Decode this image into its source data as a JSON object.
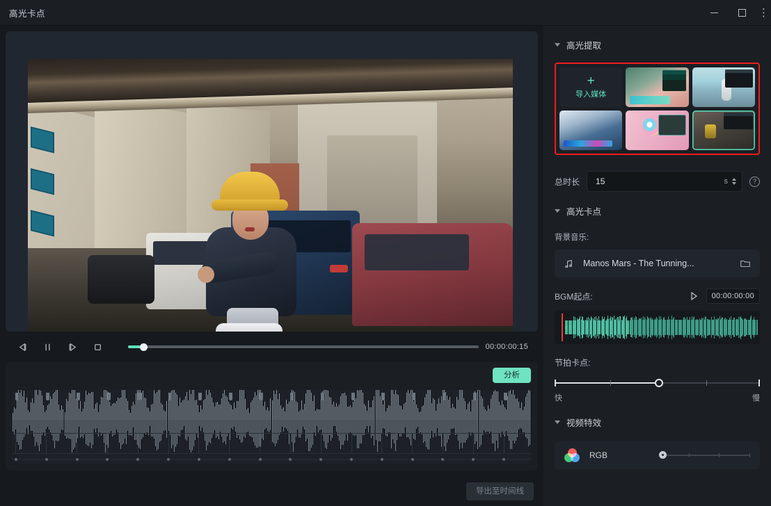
{
  "window": {
    "title": "高光卡点",
    "minimize_label": "—",
    "maximize_label": "□",
    "close_label": "⋮"
  },
  "preview": {
    "transport": {
      "prev_frame": "prev-frame",
      "pause": "pause",
      "next_frame": "next-frame",
      "stop": "stop",
      "progress_percent": 4.4,
      "timecode": "00:00:00:15"
    }
  },
  "audio_timeline": {
    "analyze_label": "分析",
    "export_label": "导出至时间线"
  },
  "panel": {
    "highlight_extract": {
      "title": "高光提取",
      "import_tile": {
        "icon": "plus-icon",
        "label": "导入媒体"
      },
      "thumbnails": [
        {
          "name": "thumbnail-1",
          "selected": false
        },
        {
          "name": "thumbnail-2",
          "selected": false
        },
        {
          "name": "thumbnail-3",
          "selected": false
        },
        {
          "name": "thumbnail-4",
          "selected": false
        },
        {
          "name": "thumbnail-5",
          "selected": true
        }
      ],
      "duration": {
        "label": "总时长",
        "value": "15",
        "unit": "s",
        "help_label": "?"
      }
    },
    "highlight_beat": {
      "title": "高光卡点",
      "bgm_label": "背景音乐:",
      "music": {
        "icon": "music-note-icon",
        "name": "Manos Mars - The Tunning...",
        "browse_icon": "folder-icon"
      },
      "bgm_start": {
        "label": "BGM起点:",
        "play_icon": "play-icon",
        "timecode": "00:00:00:00"
      },
      "beat": {
        "label": "节拍卡点:",
        "value_percent": 51,
        "min_label": "快",
        "max_label": "慢"
      }
    },
    "video_effects": {
      "title": "视频特效",
      "effects": [
        {
          "icon": "rgb-icon",
          "name": "RGB",
          "value_percent": 0
        }
      ]
    }
  },
  "colors": {
    "accent": "#5fe0bd",
    "highlight_border": "#ef1c1c",
    "panel_bg": "#1b1f24",
    "app_bg": "#16191d",
    "playhead": "#ef3b2f"
  }
}
